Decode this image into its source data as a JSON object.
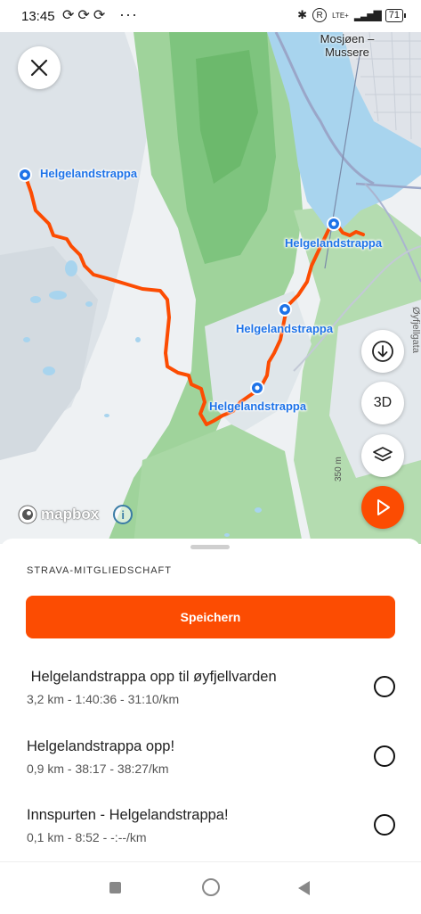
{
  "status_bar": {
    "time": "13:45",
    "sync_icons": [
      "sync-icon",
      "sync-icon",
      "sync-icon"
    ],
    "more": "···",
    "network": "LTE+",
    "battery": "71"
  },
  "map": {
    "place_label": "Mosjøen –\nMussere",
    "street_label": "Øyfjellgata",
    "elevation_label": "350 m",
    "segment_labels": [
      "Helgelandstrappa",
      "Helgelandstrappa",
      "Helgelandstrappa",
      "Helgelandstrappa"
    ],
    "attribution": "mapbox",
    "buttons": {
      "close": "close-icon",
      "download": "download-icon",
      "three_d": "3D",
      "layers": "layers-icon",
      "play": "play-icon"
    },
    "route_color": "#fc4c02"
  },
  "sheet": {
    "section_title": "STRAVA-MITGLIEDSCHAFT",
    "save_label": "Speichern",
    "segments": [
      {
        "name": " Helgelandstrappa opp til øyfjellvarden",
        "stats": "3,2 km - 1:40:36 - 31:10/km"
      },
      {
        "name": "Helgelandstrappa opp!",
        "stats": "0,9 km - 38:17 - 38:27/km"
      },
      {
        "name": "Innspurten - Helgelandstrappa!",
        "stats": "0,1 km - 8:52 - -:--/km"
      }
    ]
  },
  "colors": {
    "accent": "#fc4c02",
    "segment_blue": "#1e73e8",
    "water": "#a8d4ee",
    "forest": "#7ec47e"
  }
}
